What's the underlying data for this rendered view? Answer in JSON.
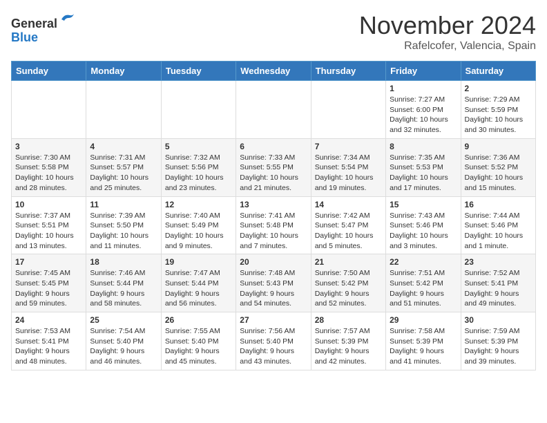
{
  "header": {
    "logo": {
      "line1": "General",
      "line2": "Blue"
    },
    "month": "November 2024",
    "location": "Rafelcofer, Valencia, Spain"
  },
  "weekdays": [
    "Sunday",
    "Monday",
    "Tuesday",
    "Wednesday",
    "Thursday",
    "Friday",
    "Saturday"
  ],
  "weeks": [
    [
      {
        "day": "",
        "info": ""
      },
      {
        "day": "",
        "info": ""
      },
      {
        "day": "",
        "info": ""
      },
      {
        "day": "",
        "info": ""
      },
      {
        "day": "",
        "info": ""
      },
      {
        "day": "1",
        "info": "Sunrise: 7:27 AM\nSunset: 6:00 PM\nDaylight: 10 hours\nand 32 minutes."
      },
      {
        "day": "2",
        "info": "Sunrise: 7:29 AM\nSunset: 5:59 PM\nDaylight: 10 hours\nand 30 minutes."
      }
    ],
    [
      {
        "day": "3",
        "info": "Sunrise: 7:30 AM\nSunset: 5:58 PM\nDaylight: 10 hours\nand 28 minutes."
      },
      {
        "day": "4",
        "info": "Sunrise: 7:31 AM\nSunset: 5:57 PM\nDaylight: 10 hours\nand 25 minutes."
      },
      {
        "day": "5",
        "info": "Sunrise: 7:32 AM\nSunset: 5:56 PM\nDaylight: 10 hours\nand 23 minutes."
      },
      {
        "day": "6",
        "info": "Sunrise: 7:33 AM\nSunset: 5:55 PM\nDaylight: 10 hours\nand 21 minutes."
      },
      {
        "day": "7",
        "info": "Sunrise: 7:34 AM\nSunset: 5:54 PM\nDaylight: 10 hours\nand 19 minutes."
      },
      {
        "day": "8",
        "info": "Sunrise: 7:35 AM\nSunset: 5:53 PM\nDaylight: 10 hours\nand 17 minutes."
      },
      {
        "day": "9",
        "info": "Sunrise: 7:36 AM\nSunset: 5:52 PM\nDaylight: 10 hours\nand 15 minutes."
      }
    ],
    [
      {
        "day": "10",
        "info": "Sunrise: 7:37 AM\nSunset: 5:51 PM\nDaylight: 10 hours\nand 13 minutes."
      },
      {
        "day": "11",
        "info": "Sunrise: 7:39 AM\nSunset: 5:50 PM\nDaylight: 10 hours\nand 11 minutes."
      },
      {
        "day": "12",
        "info": "Sunrise: 7:40 AM\nSunset: 5:49 PM\nDaylight: 10 hours\nand 9 minutes."
      },
      {
        "day": "13",
        "info": "Sunrise: 7:41 AM\nSunset: 5:48 PM\nDaylight: 10 hours\nand 7 minutes."
      },
      {
        "day": "14",
        "info": "Sunrise: 7:42 AM\nSunset: 5:47 PM\nDaylight: 10 hours\nand 5 minutes."
      },
      {
        "day": "15",
        "info": "Sunrise: 7:43 AM\nSunset: 5:46 PM\nDaylight: 10 hours\nand 3 minutes."
      },
      {
        "day": "16",
        "info": "Sunrise: 7:44 AM\nSunset: 5:46 PM\nDaylight: 10 hours\nand 1 minute."
      }
    ],
    [
      {
        "day": "17",
        "info": "Sunrise: 7:45 AM\nSunset: 5:45 PM\nDaylight: 9 hours\nand 59 minutes."
      },
      {
        "day": "18",
        "info": "Sunrise: 7:46 AM\nSunset: 5:44 PM\nDaylight: 9 hours\nand 58 minutes."
      },
      {
        "day": "19",
        "info": "Sunrise: 7:47 AM\nSunset: 5:44 PM\nDaylight: 9 hours\nand 56 minutes."
      },
      {
        "day": "20",
        "info": "Sunrise: 7:48 AM\nSunset: 5:43 PM\nDaylight: 9 hours\nand 54 minutes."
      },
      {
        "day": "21",
        "info": "Sunrise: 7:50 AM\nSunset: 5:42 PM\nDaylight: 9 hours\nand 52 minutes."
      },
      {
        "day": "22",
        "info": "Sunrise: 7:51 AM\nSunset: 5:42 PM\nDaylight: 9 hours\nand 51 minutes."
      },
      {
        "day": "23",
        "info": "Sunrise: 7:52 AM\nSunset: 5:41 PM\nDaylight: 9 hours\nand 49 minutes."
      }
    ],
    [
      {
        "day": "24",
        "info": "Sunrise: 7:53 AM\nSunset: 5:41 PM\nDaylight: 9 hours\nand 48 minutes."
      },
      {
        "day": "25",
        "info": "Sunrise: 7:54 AM\nSunset: 5:40 PM\nDaylight: 9 hours\nand 46 minutes."
      },
      {
        "day": "26",
        "info": "Sunrise: 7:55 AM\nSunset: 5:40 PM\nDaylight: 9 hours\nand 45 minutes."
      },
      {
        "day": "27",
        "info": "Sunrise: 7:56 AM\nSunset: 5:40 PM\nDaylight: 9 hours\nand 43 minutes."
      },
      {
        "day": "28",
        "info": "Sunrise: 7:57 AM\nSunset: 5:39 PM\nDaylight: 9 hours\nand 42 minutes."
      },
      {
        "day": "29",
        "info": "Sunrise: 7:58 AM\nSunset: 5:39 PM\nDaylight: 9 hours\nand 41 minutes."
      },
      {
        "day": "30",
        "info": "Sunrise: 7:59 AM\nSunset: 5:39 PM\nDaylight: 9 hours\nand 39 minutes."
      }
    ]
  ]
}
